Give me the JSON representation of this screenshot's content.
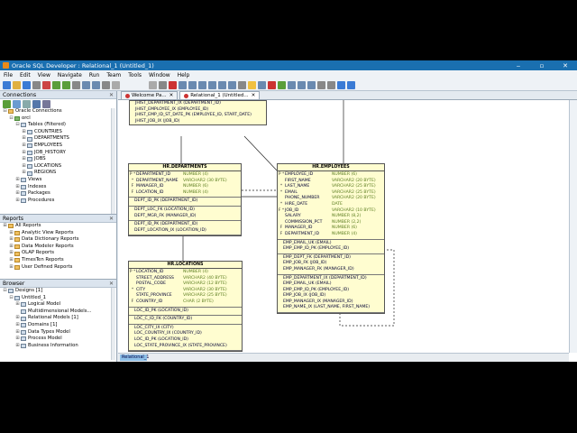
{
  "title": "Oracle SQL Developer : Relational_1 (Untitled_1)",
  "window_buttons": [
    "‒",
    "▫",
    "✕"
  ],
  "menu": [
    "File",
    "Edit",
    "View",
    "Navigate",
    "Run",
    "Team",
    "Tools",
    "Window",
    "Help"
  ],
  "connections": {
    "title": "Connections",
    "items": [
      {
        "label": "Oracle Connections",
        "indent": 0,
        "exp": "⊟",
        "icon": "o"
      },
      {
        "label": "orcl",
        "indent": 1,
        "exp": "⊟",
        "icon": "g"
      },
      {
        "label": "Tables (Filtered)",
        "indent": 2,
        "exp": "⊟",
        "icon": ""
      },
      {
        "label": "COUNTRIES",
        "indent": 3,
        "exp": "⊞",
        "icon": ""
      },
      {
        "label": "DEPARTMENTS",
        "indent": 3,
        "exp": "⊞",
        "icon": ""
      },
      {
        "label": "EMPLOYEES",
        "indent": 3,
        "exp": "⊞",
        "icon": ""
      },
      {
        "label": "JOB_HISTORY",
        "indent": 3,
        "exp": "⊞",
        "icon": ""
      },
      {
        "label": "JOBS",
        "indent": 3,
        "exp": "⊞",
        "icon": ""
      },
      {
        "label": "LOCATIONS",
        "indent": 3,
        "exp": "⊞",
        "icon": ""
      },
      {
        "label": "REGIONS",
        "indent": 3,
        "exp": "⊞",
        "icon": ""
      },
      {
        "label": "Views",
        "indent": 2,
        "exp": "⊞",
        "icon": ""
      },
      {
        "label": "Indexes",
        "indent": 2,
        "exp": "⊞",
        "icon": ""
      },
      {
        "label": "Packages",
        "indent": 2,
        "exp": "⊞",
        "icon": ""
      },
      {
        "label": "Procedures",
        "indent": 2,
        "exp": "⊞",
        "icon": ""
      }
    ]
  },
  "reports": {
    "title": "Reports",
    "items": [
      {
        "label": "All Reports",
        "indent": 0,
        "exp": "⊞",
        "icon": "o"
      },
      {
        "label": "Analytic View Reports",
        "indent": 1,
        "exp": "⊞",
        "icon": "o"
      },
      {
        "label": "Data Dictionary Reports",
        "indent": 1,
        "exp": "⊞",
        "icon": "o"
      },
      {
        "label": "Data Modeler Reports",
        "indent": 1,
        "exp": "⊞",
        "icon": "o"
      },
      {
        "label": "OLAP Reports",
        "indent": 1,
        "exp": "⊞",
        "icon": "o"
      },
      {
        "label": "TimesTen Reports",
        "indent": 1,
        "exp": "⊞",
        "icon": "o"
      },
      {
        "label": "User Defined Reports",
        "indent": 1,
        "exp": "⊞",
        "icon": "o"
      }
    ]
  },
  "browser": {
    "title": "Browser",
    "items": [
      {
        "label": "Designs [1]",
        "indent": 0,
        "exp": "⊟",
        "icon": ""
      },
      {
        "label": "Untitled_1",
        "indent": 1,
        "exp": "⊟",
        "icon": ""
      },
      {
        "label": "Logical Model",
        "indent": 2,
        "exp": "⊞",
        "icon": ""
      },
      {
        "label": "Multidimensional Models...",
        "indent": 2,
        "exp": "",
        "icon": ""
      },
      {
        "label": "Relational Models [1]",
        "indent": 2,
        "exp": "⊞",
        "icon": ""
      },
      {
        "label": "Domains [1]",
        "indent": 2,
        "exp": "⊞",
        "icon": ""
      },
      {
        "label": "Data Types Model",
        "indent": 2,
        "exp": "⊞",
        "icon": ""
      },
      {
        "label": "Process Model",
        "indent": 2,
        "exp": "⊞",
        "icon": ""
      },
      {
        "label": "Business Information",
        "indent": 2,
        "exp": "⊞",
        "icon": ""
      }
    ]
  },
  "tabs": [
    {
      "label": "Welcome Pa...",
      "active": false
    },
    {
      "label": "Relational_1 (Untitled...",
      "active": true
    }
  ],
  "bottom_tab": "Relational_1",
  "entities": {
    "jh": {
      "title": "",
      "cols": [],
      "idx": [],
      "tail": [
        "JHIST_DEPARTMENT_IX (DEPARTMENT_ID)",
        "JHIST_EMPLOYEE_IX (EMPLOYEE_ID)",
        "JHIST_EMP_ID_ST_DATE_PK (EMPLOYEE_ID, START_DATE)",
        "JHIST_JOB_IX (JOB_ID)"
      ]
    },
    "dept": {
      "title": "HR.DEPARTMENTS",
      "cols": [
        {
          "k": "P *",
          "n": "DEPARTMENT_ID",
          "t": "NUMBER (4)"
        },
        {
          "k": "*",
          "n": "DEPARTMENT_NAME",
          "t": "VARCHAR2 (30 BYTE)"
        },
        {
          "k": "F",
          "n": "MANAGER_ID",
          "t": "NUMBER (6)"
        },
        {
          "k": "F",
          "n": "LOCATION_ID",
          "t": "NUMBER (4)"
        }
      ],
      "idx": [
        [
          "DEPT_ID_PK (DEPARTMENT_ID)"
        ],
        [
          "DEPT_LOC_FK (LOCATION_ID)",
          "DEPT_MGR_FK (MANAGER_ID)"
        ],
        [
          "DEPT_ID_PK (DEPARTMENT_ID)",
          "DEPT_LOCATION_IX (LOCATION_ID)"
        ]
      ]
    },
    "emp": {
      "title": "HR.EMPLOYEES",
      "cols": [
        {
          "k": "P *",
          "n": "EMPLOYEE_ID",
          "t": "NUMBER (6)"
        },
        {
          "k": "",
          "n": "FIRST_NAME",
          "t": "VARCHAR2 (20 BYTE)"
        },
        {
          "k": "*",
          "n": "LAST_NAME",
          "t": "VARCHAR2 (25 BYTE)"
        },
        {
          "k": "*",
          "n": "EMAIL",
          "t": "VARCHAR2 (25 BYTE)"
        },
        {
          "k": "",
          "n": "PHONE_NUMBER",
          "t": "VARCHAR2 (20 BYTE)"
        },
        {
          "k": "*",
          "n": "HIRE_DATE",
          "t": "DATE"
        },
        {
          "k": "F *",
          "n": "JOB_ID",
          "t": "VARCHAR2 (10 BYTE)"
        },
        {
          "k": "",
          "n": "SALARY",
          "t": "NUMBER (8,2)"
        },
        {
          "k": "",
          "n": "COMMISSION_PCT",
          "t": "NUMBER (2,2)"
        },
        {
          "k": "F",
          "n": "MANAGER_ID",
          "t": "NUMBER (6)"
        },
        {
          "k": "F",
          "n": "DEPARTMENT_ID",
          "t": "NUMBER (4)"
        }
      ],
      "idx": [
        [
          "EMP_EMAIL_UK (EMAIL)",
          "EMP_EMP_ID_PK (EMPLOYEE_ID)"
        ],
        [
          "EMP_DEPT_FK (DEPARTMENT_ID)",
          "EMP_JOB_FK (JOB_ID)",
          "EMP_MANAGER_FK (MANAGER_ID)"
        ],
        [
          "EMP_DEPARTMENT_IX (DEPARTMENT_ID)",
          "EMP_EMAIL_UK (EMAIL)",
          "EMP_EMP_ID_PK (EMPLOYEE_ID)",
          "EMP_JOB_IX (JOB_ID)",
          "EMP_MANAGER_IX (MANAGER_ID)",
          "EMP_NAME_IX (LAST_NAME, FIRST_NAME)"
        ]
      ]
    },
    "loc": {
      "title": "HR.LOCATIONS",
      "cols": [
        {
          "k": "P *",
          "n": "LOCATION_ID",
          "t": "NUMBER (4)"
        },
        {
          "k": "",
          "n": "STREET_ADDRESS",
          "t": "VARCHAR2 (40 BYTE)"
        },
        {
          "k": "",
          "n": "POSTAL_CODE",
          "t": "VARCHAR2 (12 BYTE)"
        },
        {
          "k": "*",
          "n": "CITY",
          "t": "VARCHAR2 (30 BYTE)"
        },
        {
          "k": "",
          "n": "STATE_PROVINCE",
          "t": "VARCHAR2 (25 BYTE)"
        },
        {
          "k": "F",
          "n": "COUNTRY_ID",
          "t": "CHAR (2 BYTE)"
        }
      ],
      "idx": [
        [
          "LOC_ID_PK (LOCATION_ID)"
        ],
        [
          "LOC_C_ID_FK (COUNTRY_ID)"
        ],
        [
          "LOC_CITY_IX (CITY)",
          "LOC_COUNTRY_IX (COUNTRY_ID)",
          "LOC_ID_PK (LOCATION_ID)",
          "LOC_STATE_PROVINCE_IX (STATE_PROVINCE)"
        ]
      ]
    }
  },
  "colors": {
    "title_bar": "#1a6fb0",
    "entity_bg": "#fffdd0",
    "type_text": "#5a7d1e"
  }
}
